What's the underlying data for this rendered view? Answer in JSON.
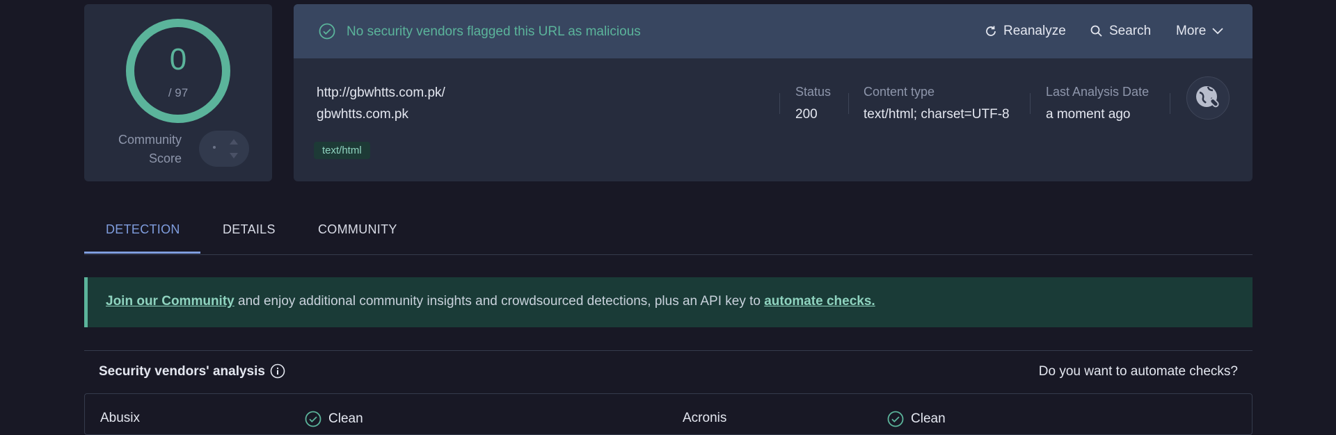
{
  "score": {
    "value": "0",
    "total": "/ 97",
    "community_label_1": "Community",
    "community_label_2": "Score",
    "color": "#5bb49b"
  },
  "banner": {
    "message": "No security vendors flagged this URL as malicious",
    "reanalyze": "Reanalyze",
    "search": "Search",
    "more": "More"
  },
  "url": {
    "full": "http://gbwhtts.com.pk/",
    "domain": "gbwhtts.com.pk",
    "tag": "text/html"
  },
  "meta": {
    "status_label": "Status",
    "status_value": "200",
    "content_type_label": "Content type",
    "content_type_value": "text/html; charset=UTF-8",
    "last_analysis_label": "Last Analysis Date",
    "last_analysis_value": "a moment ago"
  },
  "tabs": [
    {
      "label": "DETECTION",
      "active": true
    },
    {
      "label": "DETAILS",
      "active": false
    },
    {
      "label": "COMMUNITY",
      "active": false
    }
  ],
  "community_banner": {
    "link_1": "Join our Community",
    "text": " and enjoy additional community insights and crowdsourced detections, plus an API key to ",
    "link_2": "automate checks."
  },
  "vendors": {
    "title": "Security vendors' analysis",
    "automate_question": "Do you want to automate checks?"
  },
  "vendor_rows": [
    {
      "left_name": "Abusix",
      "left_result": "Clean",
      "right_name": "Acronis",
      "right_result": "Clean"
    }
  ],
  "colors": {
    "accent": "#7f9dde",
    "clean": "#5bb49b",
    "background": "#181825",
    "card": "#262c3d"
  }
}
